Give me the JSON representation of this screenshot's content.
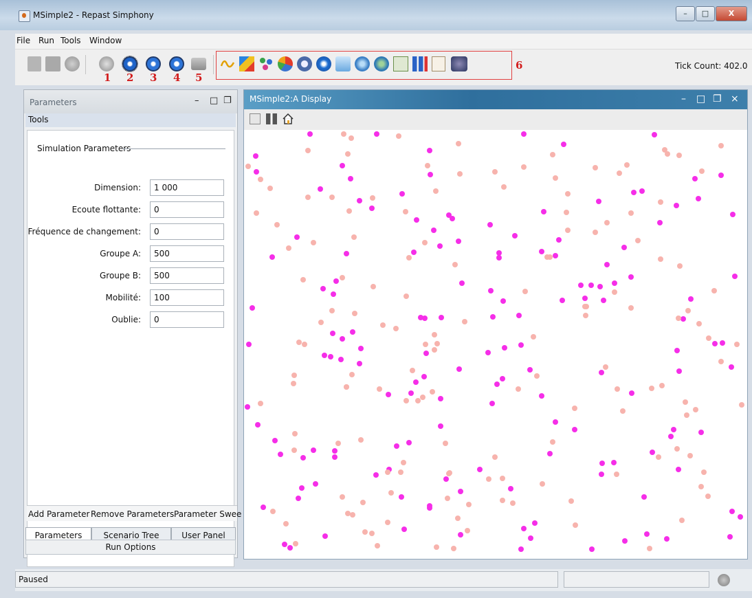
{
  "window": {
    "title": "MSimple2 - Repast Simphony",
    "minimize_glyph": "–",
    "maximize_glyph": "□",
    "close_glyph": "X"
  },
  "menubar": {
    "items": [
      "File",
      "Run",
      "Tools",
      "Window"
    ]
  },
  "toolbar": {
    "annotations": [
      "1",
      "2",
      "3",
      "4",
      "5",
      "6"
    ],
    "tick_count": "Tick Count: 402.0"
  },
  "parameters_panel": {
    "title": "Parameters",
    "tools_label": "Tools",
    "section_label": "Simulation Parameters",
    "params": [
      {
        "label": "Dimension:",
        "value": "1 000"
      },
      {
        "label": "Ecoute flottante:",
        "value": "0"
      },
      {
        "label": "Fréquence de changement:",
        "value": "0"
      },
      {
        "label": "Groupe A:",
        "value": "500"
      },
      {
        "label": "Groupe B:",
        "value": "500"
      },
      {
        "label": "Mobilité:",
        "value": "100"
      },
      {
        "label": "Oublie:",
        "value": "0"
      }
    ],
    "actions": [
      "Add Parameter",
      "Remove Parameters",
      "Parameter Swee"
    ],
    "tabs": [
      "Parameters",
      "Scenario Tree",
      "User Panel"
    ],
    "run_options": "Run Options"
  },
  "display": {
    "title": "MSimple2:A Display",
    "colors": {
      "group_a": "#f52ee8",
      "group_b": "#f7b3ad"
    }
  },
  "status": {
    "text": "Paused"
  }
}
